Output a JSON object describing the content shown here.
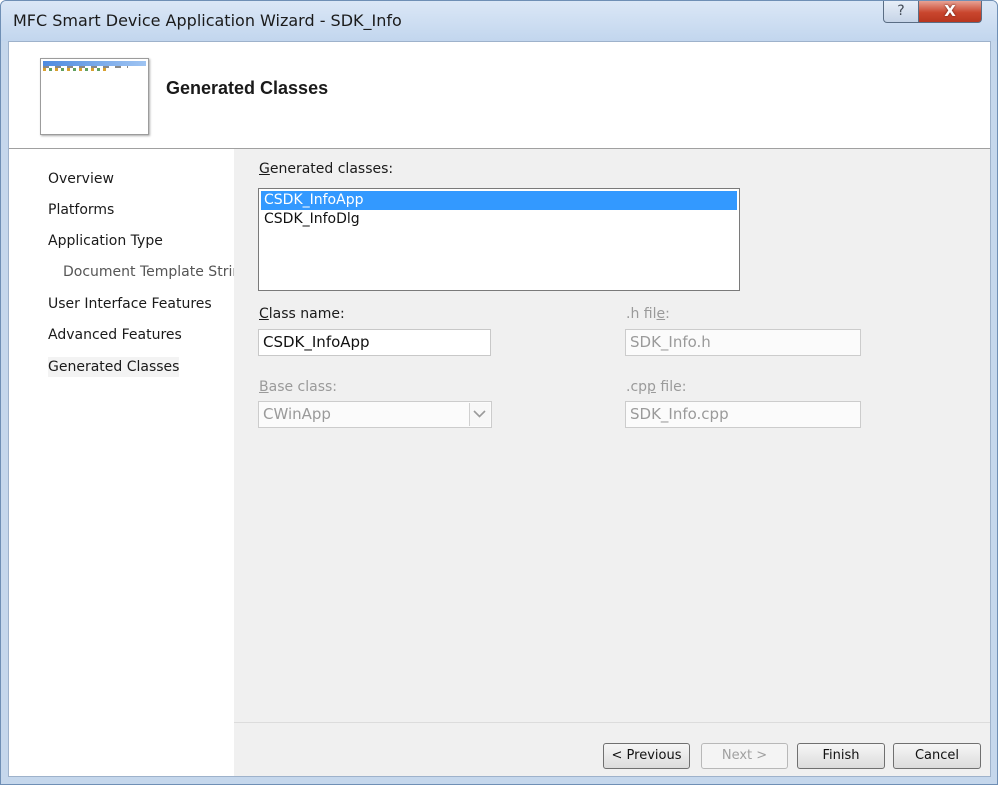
{
  "window": {
    "title": "MFC Smart Device Application Wizard - SDK_Info",
    "help_glyph": "?",
    "close_glyph": "X"
  },
  "banner": {
    "title": "Generated Classes"
  },
  "sidebar": {
    "items": [
      {
        "label": "Overview"
      },
      {
        "label": "Platforms"
      },
      {
        "label": "Application Type"
      },
      {
        "label": "Document Template Strings"
      },
      {
        "label": "User Interface Features"
      },
      {
        "label": "Advanced Features"
      },
      {
        "label": "Generated Classes"
      }
    ],
    "selected": "Generated Classes"
  },
  "form": {
    "generated_classes": {
      "label_first": "G",
      "label_rest": "enerated classes:",
      "items": [
        "CSDK_InfoApp",
        "CSDK_InfoDlg"
      ],
      "selected": "CSDK_InfoApp"
    },
    "class_name": {
      "label_first": "C",
      "label_rest": "lass name:",
      "value": "CSDK_InfoApp"
    },
    "h_file": {
      "label_pre": ".h fil",
      "label_u": "e",
      "label_post": ":",
      "value": "SDK_Info.h"
    },
    "base_class": {
      "label_first": "B",
      "label_rest": "ase class:",
      "value": "CWinApp"
    },
    "cpp_file": {
      "label_pre": ".cp",
      "label_u": "p",
      "label_post": " file:",
      "value": "SDK_Info.cpp"
    }
  },
  "buttons": {
    "previous": "< Previous",
    "next": "Next >",
    "finish": "Finish",
    "cancel": "Cancel"
  }
}
